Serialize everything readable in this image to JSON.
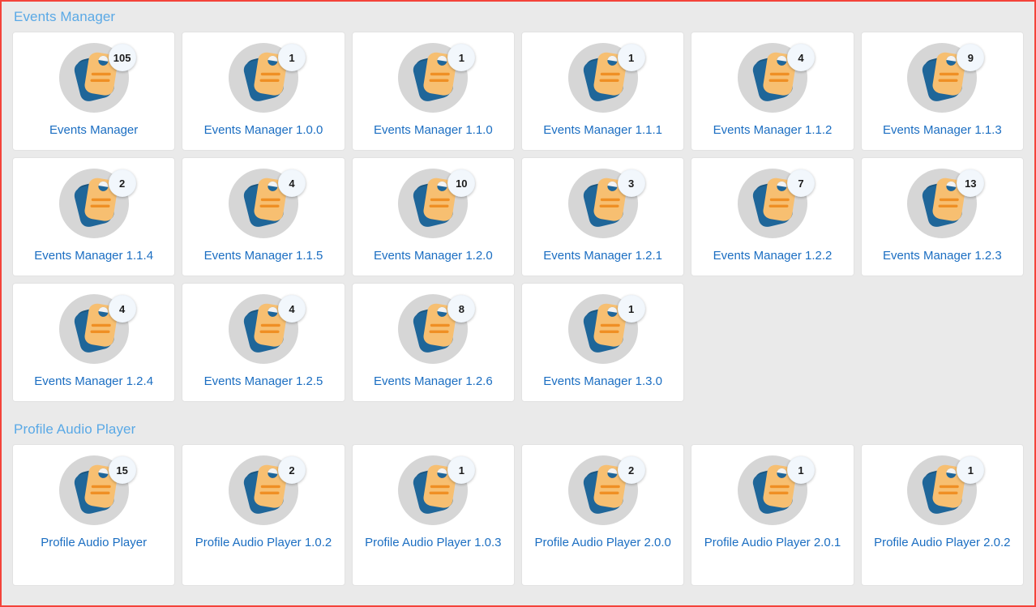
{
  "page": {
    "background_color": "#eaeaea",
    "border_color": "#f4433a",
    "header_color": "#5aa9e6",
    "label_color": "#1b6ec2",
    "badge_background": "#f2f7fc",
    "card_background": "#ffffff",
    "card_border_color": "#e2e2e2",
    "icon_circle_color": "#d6d6d6",
    "icon_blue_color": "#1f6699",
    "icon_blue_shadow_color": "#1a5680",
    "icon_orange_color": "#f7bf71",
    "icon_orange_line_color": "#ef8f24"
  },
  "sections": [
    {
      "title": "Events Manager",
      "icon": "tags-icon",
      "cards": [
        {
          "label": "Events Manager",
          "count": "105"
        },
        {
          "label": "Events Manager 1.0.0",
          "count": "1"
        },
        {
          "label": "Events Manager 1.1.0",
          "count": "1"
        },
        {
          "label": "Events Manager 1.1.1",
          "count": "1"
        },
        {
          "label": "Events Manager 1.1.2",
          "count": "4"
        },
        {
          "label": "Events Manager 1.1.3",
          "count": "9"
        },
        {
          "label": "Events Manager 1.1.4",
          "count": "2"
        },
        {
          "label": "Events Manager 1.1.5",
          "count": "4"
        },
        {
          "label": "Events Manager 1.2.0",
          "count": "10"
        },
        {
          "label": "Events Manager 1.2.1",
          "count": "3"
        },
        {
          "label": "Events Manager 1.2.2",
          "count": "7"
        },
        {
          "label": "Events Manager 1.2.3",
          "count": "13"
        },
        {
          "label": "Events Manager 1.2.4",
          "count": "4"
        },
        {
          "label": "Events Manager 1.2.5",
          "count": "4"
        },
        {
          "label": "Events Manager 1.2.6",
          "count": "8"
        },
        {
          "label": "Events Manager 1.3.0",
          "count": "1"
        }
      ]
    },
    {
      "title": "Profile Audio Player",
      "icon": "tags-icon",
      "tall_cards": true,
      "cards": [
        {
          "label": "Profile Audio Player",
          "count": "15"
        },
        {
          "label": "Profile Audio Player 1.0.2",
          "count": "2"
        },
        {
          "label": "Profile Audio Player 1.0.3",
          "count": "1"
        },
        {
          "label": "Profile Audio Player 2.0.0",
          "count": "2"
        },
        {
          "label": "Profile Audio Player 2.0.1",
          "count": "1"
        },
        {
          "label": "Profile Audio Player 2.0.2",
          "count": "1"
        }
      ]
    }
  ]
}
